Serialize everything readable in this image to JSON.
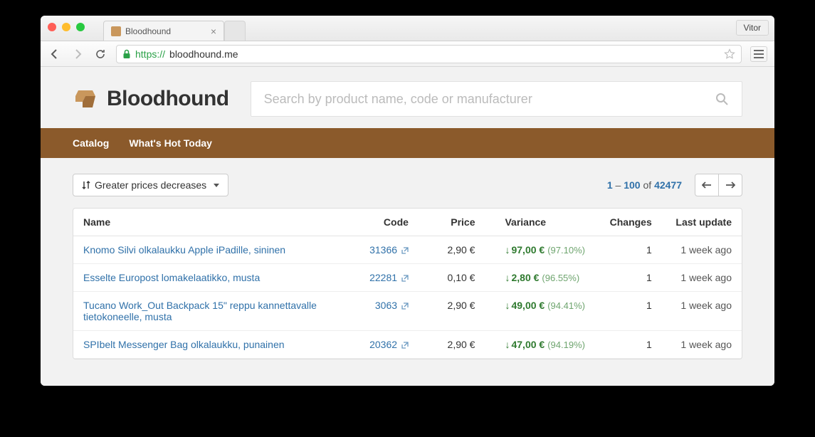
{
  "browser": {
    "tab_title": "Bloodhound",
    "user": "Vitor",
    "url_proto": "https://",
    "url_domain": "bloodhound.me"
  },
  "header": {
    "site_title": "Bloodhound",
    "search_placeholder": "Search by product name, code or manufacturer"
  },
  "nav": {
    "catalog": "Catalog",
    "hot": "What's Hot Today"
  },
  "controls": {
    "sort_label": "Greater prices decreases",
    "range_start": "1",
    "range_end": "100",
    "range_of": "of",
    "range_total": "42477"
  },
  "columns": {
    "name": "Name",
    "code": "Code",
    "price": "Price",
    "variance": "Variance",
    "changes": "Changes",
    "last_update": "Last update"
  },
  "rows": [
    {
      "name": "Knomo Silvi olkalaukku Apple iPadille, sininen",
      "code": "31366",
      "price": "2,90 €",
      "var_amount": "97,00 €",
      "var_pct": "(97.10%)",
      "changes": "1",
      "updated": "1 week ago"
    },
    {
      "name": "Esselte Europost lomakelaatikko, musta",
      "code": "22281",
      "price": "0,10 €",
      "var_amount": "2,80 €",
      "var_pct": "(96.55%)",
      "changes": "1",
      "updated": "1 week ago"
    },
    {
      "name": "Tucano Work_Out Backpack 15\" reppu kannettavalle tietokoneelle, musta",
      "code": "3063",
      "price": "2,90 €",
      "var_amount": "49,00 €",
      "var_pct": "(94.41%)",
      "changes": "1",
      "updated": "1 week ago"
    },
    {
      "name": "SPIbelt Messenger Bag olkalaukku, punainen",
      "code": "20362",
      "price": "2,90 €",
      "var_amount": "47,00 €",
      "var_pct": "(94.19%)",
      "changes": "1",
      "updated": "1 week ago"
    }
  ]
}
